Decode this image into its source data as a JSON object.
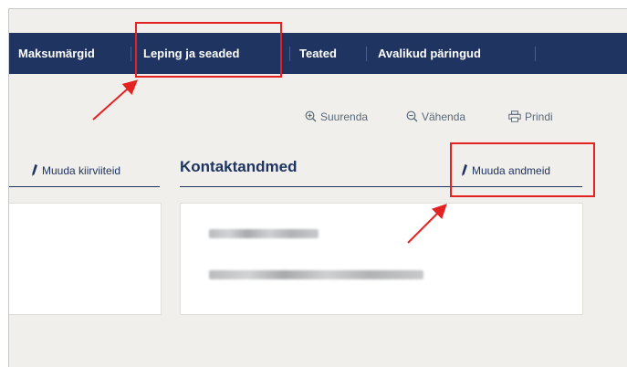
{
  "nav": {
    "items": [
      {
        "label": "Maksumärgid"
      },
      {
        "label": "Leping ja seaded"
      },
      {
        "label": "Teated"
      },
      {
        "label": "Avalikud päringud"
      }
    ]
  },
  "toolbar": {
    "zoom_in": "Suurenda",
    "zoom_out": "Vähenda",
    "print": "Prindi"
  },
  "left_section": {
    "edit_label": "Muuda kiirviiteid"
  },
  "contact_section": {
    "title": "Kontaktandmed",
    "edit_label": "Muuda andmeid",
    "blurred_lines": [
      "redacted-name",
      "redacted-address"
    ]
  },
  "annotations": {
    "highlight_color": "#e32222"
  }
}
